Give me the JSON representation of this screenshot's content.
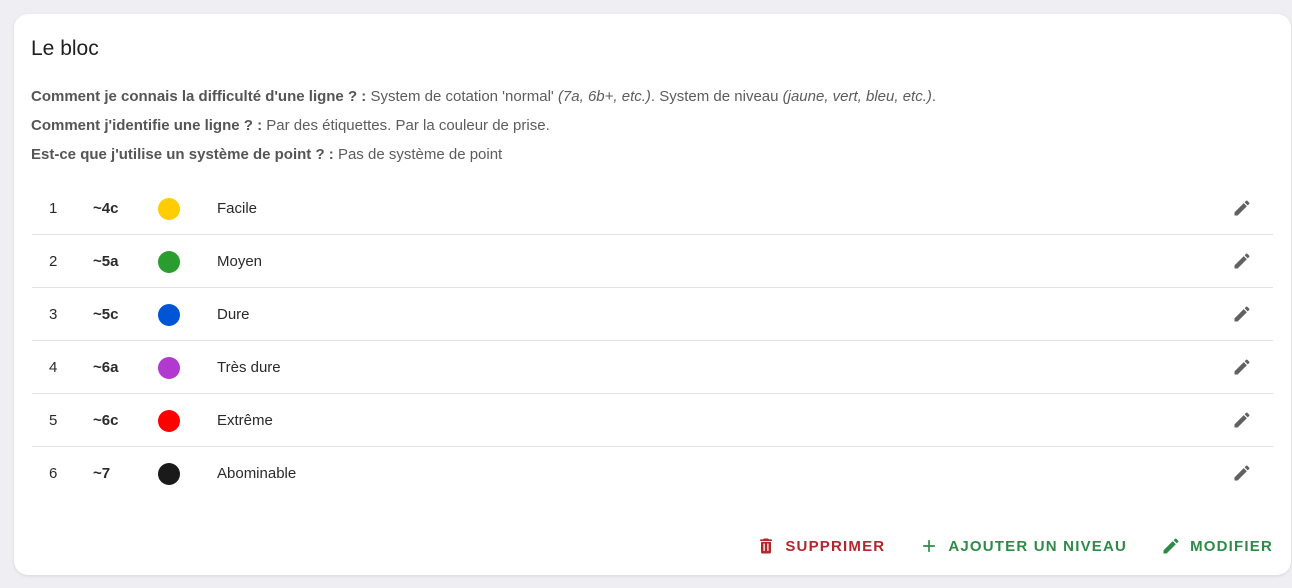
{
  "card": {
    "title": "Le bloc",
    "info": [
      {
        "question": "Comment je connais la difficulté d'une ligne ? :",
        "text1": " System de cotation 'normal' ",
        "italic1": "(7a, 6b+, etc.)",
        "text2": ". System de niveau ",
        "italic2": "(jaune, vert, bleu, etc.)",
        "text3": "."
      },
      {
        "question": "Comment j'identifie une ligne ? :",
        "text1": " Par des étiquettes. Par la couleur de prise."
      },
      {
        "question": "Est-ce que j'utilise un système de point ? :",
        "text1": " Pas de système de point"
      }
    ]
  },
  "levels": [
    {
      "num": "1",
      "grade": "~4c",
      "color": "#ffcc00",
      "name": "Facile"
    },
    {
      "num": "2",
      "grade": "~5a",
      "color": "#2a9d2f",
      "name": "Moyen"
    },
    {
      "num": "3",
      "grade": "~5c",
      "color": "#0055d4",
      "name": "Dure"
    },
    {
      "num": "4",
      "grade": "~6a",
      "color": "#b03ad0",
      "name": "Très dure"
    },
    {
      "num": "5",
      "grade": "~6c",
      "color": "#ff0000",
      "name": "Extrême"
    },
    {
      "num": "6",
      "grade": "~7",
      "color": "#1a1a1a",
      "name": "Abominable"
    }
  ],
  "icons": {
    "edit": "pencil-icon",
    "delete": "trash-icon",
    "add": "plus-icon"
  },
  "actions": {
    "delete_label": "SUPPRIMER",
    "add_label": "AJOUTER UN NIVEAU",
    "edit_label": "MODIFIER"
  },
  "colors": {
    "danger": "#b3262d",
    "success": "#2e8b47",
    "background": "#efeef3"
  }
}
